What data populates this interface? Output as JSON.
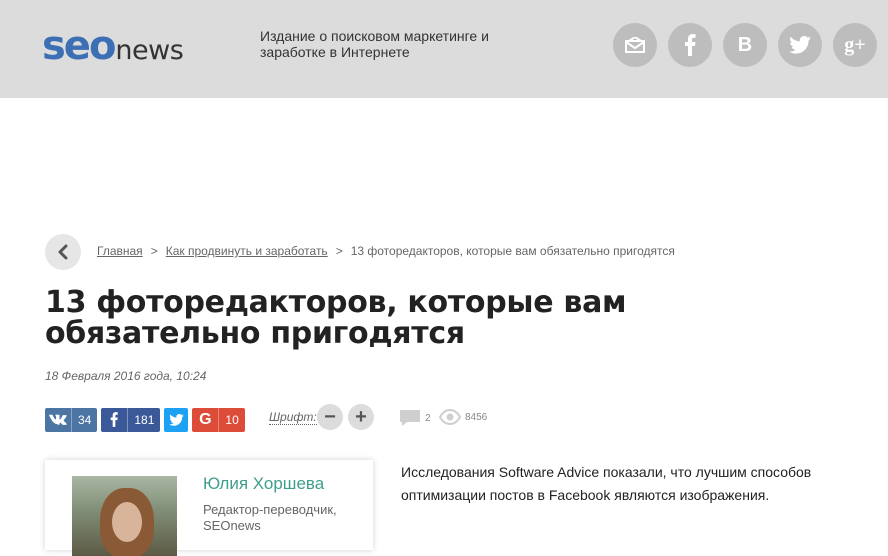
{
  "header": {
    "logo_seo": "seo",
    "logo_news": "news",
    "tagline": "Издание о поисковом маркетинге и заработке в Интернете",
    "social": [
      "mail-icon",
      "facebook-icon",
      "vk-icon",
      "twitter-icon",
      "google-plus-icon"
    ]
  },
  "breadcrumb": {
    "home": "Главная",
    "section": "Как продвинуть и заработать",
    "current": "13 фоторедакторов, которые вам обязательно пригодятся",
    "separator": ">"
  },
  "article": {
    "title": "13 фоторедакторов, которые вам обязательно пригодятся",
    "date": "18 Февраля 2016 года, 10:24",
    "lead": " Исследования Software Advice показали, что лучшим способов оптимизации постов в Facebook являются изображения."
  },
  "share": {
    "vk_count": "34",
    "fb_count": "181",
    "gp_count": "10",
    "vk_label": "vk",
    "fb_label": "f",
    "gp_label": "G"
  },
  "font_control": {
    "label": "Шрифт:",
    "minus": "−",
    "plus": "+"
  },
  "stats": {
    "comments": "2",
    "views": "8456"
  },
  "author": {
    "name": "Юлия Хоршева",
    "role": "Редактор-переводчик, SEOnews"
  },
  "colors": {
    "header_bg": "#dcdcdc",
    "logo_blue": "#3d6fb5",
    "vk": "#4c75a3",
    "facebook": "#3b5998",
    "twitter": "#1da1f2",
    "google": "#dd4b39",
    "author_link": "#3f9e8a"
  }
}
